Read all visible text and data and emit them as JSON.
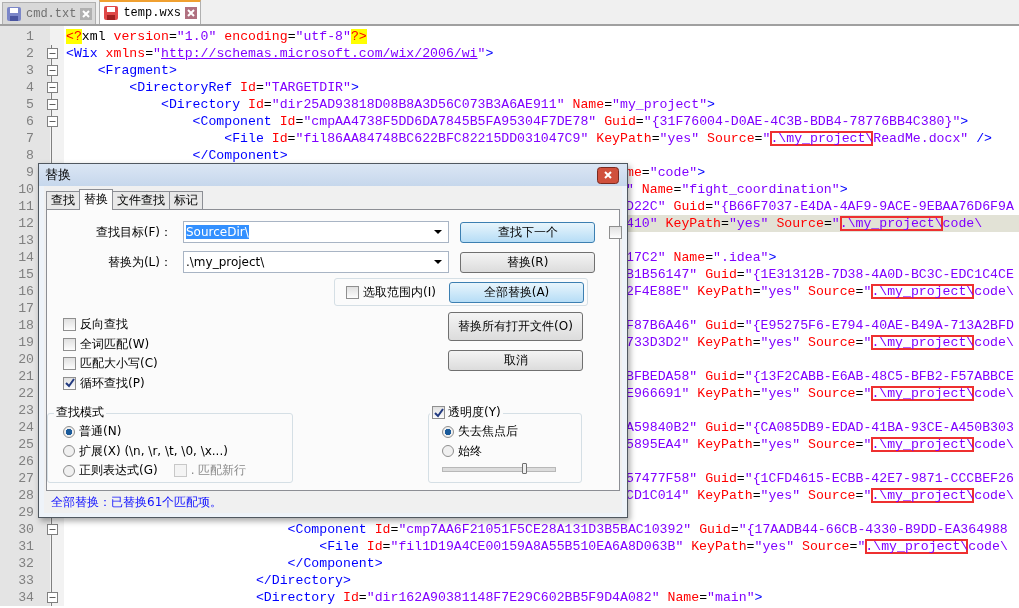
{
  "tabs": [
    {
      "label": "cmd.txt",
      "selected": false,
      "saved": true
    },
    {
      "label": "temp.wxs",
      "selected": true,
      "saved": false
    }
  ],
  "editor": {
    "lines": [
      {
        "number": "1",
        "kind": "full",
        "fold": false,
        "current": false,
        "tokens": [
          {
            "kind": "pi",
            "text": "<?"
          },
          {
            "kind": "plain",
            "text": "xml"
          },
          {
            "kind": "attr",
            "text": " version"
          },
          {
            "kind": "punct",
            "text": "="
          },
          {
            "kind": "value",
            "text": "\"1.0\""
          },
          {
            "kind": "attr",
            "text": " encoding"
          },
          {
            "kind": "punct",
            "text": "="
          },
          {
            "kind": "value",
            "text": "\"utf-8\""
          },
          {
            "kind": "pi",
            "text": "?>"
          }
        ]
      },
      {
        "number": "2",
        "kind": "full",
        "fold": true,
        "current": false,
        "tokens": [
          {
            "kind": "tag",
            "text": "<Wix"
          },
          {
            "kind": "attr",
            "text": " xmlns"
          },
          {
            "kind": "punct",
            "text": "="
          },
          {
            "kind": "value",
            "text": "\""
          },
          {
            "kind": "url",
            "text": "http://schemas.microsoft.com/wix/2006/wi"
          },
          {
            "kind": "value",
            "text": "\""
          },
          {
            "kind": "tag",
            "text": ">"
          }
        ]
      },
      {
        "number": "3",
        "kind": "full",
        "fold": true,
        "current": false,
        "tokens": [
          {
            "kind": "tag",
            "text": "    <Fragment>"
          }
        ]
      },
      {
        "number": "4",
        "kind": "full",
        "fold": true,
        "current": false,
        "tokens": [
          {
            "kind": "tag",
            "text": "        <DirectoryRef"
          },
          {
            "kind": "attr",
            "text": " Id"
          },
          {
            "kind": "punct",
            "text": "="
          },
          {
            "kind": "value",
            "text": "\"TARGETDIR\""
          },
          {
            "kind": "tag",
            "text": ">"
          }
        ]
      },
      {
        "number": "5",
        "kind": "full",
        "fold": true,
        "current": false,
        "tokens": [
          {
            "kind": "tag",
            "text": "            <Directory"
          },
          {
            "kind": "attr",
            "text": " Id"
          },
          {
            "kind": "punct",
            "text": "="
          },
          {
            "kind": "value",
            "text": "\"dir25AD93818D08B8A3D56C073B3A6AE911\""
          },
          {
            "kind": "attr",
            "text": " Name"
          },
          {
            "kind": "punct",
            "text": "="
          },
          {
            "kind": "value",
            "text": "\"my_project\""
          },
          {
            "kind": "tag",
            "text": ">"
          }
        ]
      },
      {
        "number": "6",
        "kind": "full",
        "fold": true,
        "current": false,
        "tokens": [
          {
            "kind": "tag",
            "text": "                <Component"
          },
          {
            "kind": "attr",
            "text": " Id"
          },
          {
            "kind": "punct",
            "text": "="
          },
          {
            "kind": "value",
            "text": "\"cmpAA4738F5DD6DA7845B5FA95304F7DE78\""
          },
          {
            "kind": "attr",
            "text": " Guid"
          },
          {
            "kind": "punct",
            "text": "="
          },
          {
            "kind": "value",
            "text": "\"{31F76004-D0AE-4C3B-BDB4-78776BB4C380}\""
          },
          {
            "kind": "tag",
            "text": ">"
          }
        ]
      },
      {
        "number": "7",
        "kind": "full",
        "fold": false,
        "current": false,
        "tokens": [
          {
            "kind": "tag",
            "text": "                    <File"
          },
          {
            "kind": "attr",
            "text": " Id"
          },
          {
            "kind": "punct",
            "text": "="
          },
          {
            "kind": "value",
            "text": "\"fil86AA84748BC622BFC82215DD031047C9\""
          },
          {
            "kind": "attr",
            "text": " KeyPath"
          },
          {
            "kind": "punct",
            "text": "="
          },
          {
            "kind": "value",
            "text": "\"yes\""
          },
          {
            "kind": "attr",
            "text": " Source"
          },
          {
            "kind": "punct",
            "text": "="
          },
          {
            "kind": "value",
            "text": "\""
          },
          {
            "kind": "match",
            "text": ".\\my_project\\"
          },
          {
            "kind": "value",
            "text": "ReadMe.docx\""
          },
          {
            "kind": "tag",
            "text": " />"
          }
        ]
      },
      {
        "number": "8",
        "kind": "full",
        "fold": false,
        "current": false,
        "tokens": [
          {
            "kind": "tag",
            "text": "                </Component>"
          }
        ]
      },
      {
        "number": "9",
        "kind": "covered",
        "current": false,
        "tokens": [
          {
            "kind": "attr",
            "text": "me"
          },
          {
            "kind": "punct",
            "text": "="
          },
          {
            "kind": "value",
            "text": "\"code\""
          },
          {
            "kind": "tag",
            "text": ">"
          }
        ]
      },
      {
        "number": "10",
        "kind": "covered",
        "current": false,
        "tokens": [
          {
            "kind": "value",
            "text": "\""
          },
          {
            "kind": "attr",
            "text": " Name"
          },
          {
            "kind": "punct",
            "text": "="
          },
          {
            "kind": "value",
            "text": "\"fight_coordination\""
          },
          {
            "kind": "tag",
            "text": ">"
          }
        ]
      },
      {
        "number": "11",
        "kind": "covered",
        "current": false,
        "tokens": [
          {
            "kind": "value",
            "text": "D22C\""
          },
          {
            "kind": "attr",
            "text": " Guid"
          },
          {
            "kind": "punct",
            "text": "="
          },
          {
            "kind": "value",
            "text": "\"{B66F7037-E4DA-4AF9-9ACE-9EBAA76D6F9A"
          }
        ]
      },
      {
        "number": "12",
        "kind": "covered",
        "current": true,
        "tokens": [
          {
            "kind": "value",
            "text": "410\""
          },
          {
            "kind": "attr",
            "text": " KeyPath"
          },
          {
            "kind": "punct",
            "text": "="
          },
          {
            "kind": "value",
            "text": "\"yes\""
          },
          {
            "kind": "attr",
            "text": " Source"
          },
          {
            "kind": "punct",
            "text": "="
          },
          {
            "kind": "value",
            "text": "\""
          },
          {
            "kind": "match",
            "text": ".\\my_project\\"
          },
          {
            "kind": "value",
            "text": "code\\"
          }
        ]
      },
      {
        "number": "13",
        "kind": "covered",
        "current": false
      },
      {
        "number": "14",
        "kind": "covered",
        "current": false,
        "tokens": [
          {
            "kind": "value",
            "text": "17C2\""
          },
          {
            "kind": "attr",
            "text": " Name"
          },
          {
            "kind": "punct",
            "text": "="
          },
          {
            "kind": "value",
            "text": "\".idea\""
          },
          {
            "kind": "tag",
            "text": ">"
          }
        ]
      },
      {
        "number": "15",
        "kind": "covered",
        "current": false,
        "tokens": [
          {
            "kind": "value",
            "text": "B1B56147\""
          },
          {
            "kind": "attr",
            "text": " Guid"
          },
          {
            "kind": "punct",
            "text": "="
          },
          {
            "kind": "value",
            "text": "\"{1E31312B-7D38-4A0D-BC3C-EDC1C4CE"
          }
        ]
      },
      {
        "number": "16",
        "kind": "covered",
        "current": false,
        "tokens": [
          {
            "kind": "value",
            "text": "2F4E88E\""
          },
          {
            "kind": "attr",
            "text": " KeyPath"
          },
          {
            "kind": "punct",
            "text": "="
          },
          {
            "kind": "value",
            "text": "\"yes\""
          },
          {
            "kind": "attr",
            "text": " Source"
          },
          {
            "kind": "punct",
            "text": "="
          },
          {
            "kind": "value",
            "text": "\""
          },
          {
            "kind": "match",
            "text": ".\\my_project\\"
          },
          {
            "kind": "value",
            "text": "code\\"
          }
        ]
      },
      {
        "number": "17",
        "kind": "covered",
        "current": false
      },
      {
        "number": "18",
        "kind": "covered",
        "current": false,
        "tokens": [
          {
            "kind": "value",
            "text": "F87B6A46\""
          },
          {
            "kind": "attr",
            "text": " Guid"
          },
          {
            "kind": "punct",
            "text": "="
          },
          {
            "kind": "value",
            "text": "\"{E95275F6-E794-40AE-B49A-713A2BFD"
          }
        ]
      },
      {
        "number": "19",
        "kind": "covered",
        "current": false,
        "tokens": [
          {
            "kind": "value",
            "text": "733D3D2\""
          },
          {
            "kind": "attr",
            "text": " KeyPath"
          },
          {
            "kind": "punct",
            "text": "="
          },
          {
            "kind": "value",
            "text": "\"yes\""
          },
          {
            "kind": "attr",
            "text": " Source"
          },
          {
            "kind": "punct",
            "text": "="
          },
          {
            "kind": "value",
            "text": "\""
          },
          {
            "kind": "match",
            "text": ".\\my_project\\"
          },
          {
            "kind": "value",
            "text": "code\\"
          }
        ]
      },
      {
        "number": "20",
        "kind": "covered",
        "current": false
      },
      {
        "number": "21",
        "kind": "covered",
        "current": false,
        "tokens": [
          {
            "kind": "value",
            "text": "BFBEDA58\""
          },
          {
            "kind": "attr",
            "text": " Guid"
          },
          {
            "kind": "punct",
            "text": "="
          },
          {
            "kind": "value",
            "text": "\"{13F2CABB-E6AB-48C5-BFB2-F57ABBCE"
          }
        ]
      },
      {
        "number": "22",
        "kind": "covered",
        "current": false,
        "tokens": [
          {
            "kind": "value",
            "text": "E966691\""
          },
          {
            "kind": "attr",
            "text": " KeyPath"
          },
          {
            "kind": "punct",
            "text": "="
          },
          {
            "kind": "value",
            "text": "\"yes\""
          },
          {
            "kind": "attr",
            "text": " Source"
          },
          {
            "kind": "punct",
            "text": "="
          },
          {
            "kind": "value",
            "text": "\""
          },
          {
            "kind": "match",
            "text": ".\\my_project\\"
          },
          {
            "kind": "value",
            "text": "code\\"
          }
        ]
      },
      {
        "number": "23",
        "kind": "covered",
        "current": false
      },
      {
        "number": "24",
        "kind": "covered",
        "current": false,
        "tokens": [
          {
            "kind": "value",
            "text": "A59840B2\""
          },
          {
            "kind": "attr",
            "text": " Guid"
          },
          {
            "kind": "punct",
            "text": "="
          },
          {
            "kind": "value",
            "text": "\"{CA085DB9-EDAD-41BA-93CE-A450B303"
          }
        ]
      },
      {
        "number": "25",
        "kind": "covered",
        "current": false,
        "tokens": [
          {
            "kind": "value",
            "text": "5895EA4\""
          },
          {
            "kind": "attr",
            "text": " KeyPath"
          },
          {
            "kind": "punct",
            "text": "="
          },
          {
            "kind": "value",
            "text": "\"yes\""
          },
          {
            "kind": "attr",
            "text": " Source"
          },
          {
            "kind": "punct",
            "text": "="
          },
          {
            "kind": "value",
            "text": "\""
          },
          {
            "kind": "match",
            "text": ".\\my_project\\"
          },
          {
            "kind": "value",
            "text": "code\\"
          }
        ]
      },
      {
        "number": "26",
        "kind": "covered",
        "current": false
      },
      {
        "number": "27",
        "kind": "covered",
        "current": false,
        "tokens": [
          {
            "kind": "value",
            "text": "57477F58\""
          },
          {
            "kind": "attr",
            "text": " Guid"
          },
          {
            "kind": "punct",
            "text": "="
          },
          {
            "kind": "value",
            "text": "\"{1CFD4615-ECBB-42E7-9871-CCCBEF26"
          }
        ]
      },
      {
        "number": "28",
        "kind": "covered",
        "current": false,
        "tokens": [
          {
            "kind": "value",
            "text": "CD1C014\""
          },
          {
            "kind": "attr",
            "text": " KeyPath"
          },
          {
            "kind": "punct",
            "text": "="
          },
          {
            "kind": "value",
            "text": "\"yes\""
          },
          {
            "kind": "attr",
            "text": " Source"
          },
          {
            "kind": "punct",
            "text": "="
          },
          {
            "kind": "value",
            "text": "\""
          },
          {
            "kind": "match",
            "text": ".\\my_project\\"
          },
          {
            "kind": "value",
            "text": "code\\"
          }
        ]
      },
      {
        "number": "29",
        "kind": "covered",
        "current": false
      },
      {
        "number": "30",
        "kind": "full",
        "fold": true,
        "current": false,
        "tokens": [
          {
            "kind": "tag",
            "text": "                            <Component"
          },
          {
            "kind": "attr",
            "text": " Id"
          },
          {
            "kind": "punct",
            "text": "="
          },
          {
            "kind": "value",
            "text": "\"cmp7AA6F21051F5CE28A131D3B5BAC10392\""
          },
          {
            "kind": "attr",
            "text": " Guid"
          },
          {
            "kind": "punct",
            "text": "="
          },
          {
            "kind": "value",
            "text": "\"{17AADB44-66CB-4330-B9DD-EA364988"
          }
        ]
      },
      {
        "number": "31",
        "kind": "full",
        "fold": false,
        "current": false,
        "tokens": [
          {
            "kind": "tag",
            "text": "                                <File"
          },
          {
            "kind": "attr",
            "text": " Id"
          },
          {
            "kind": "punct",
            "text": "="
          },
          {
            "kind": "value",
            "text": "\"fil1D19A4CE00159A8A55B510EA6A8D063B\""
          },
          {
            "kind": "attr",
            "text": " KeyPath"
          },
          {
            "kind": "punct",
            "text": "="
          },
          {
            "kind": "value",
            "text": "\"yes\""
          },
          {
            "kind": "attr",
            "text": " Source"
          },
          {
            "kind": "punct",
            "text": "="
          },
          {
            "kind": "value",
            "text": "\""
          },
          {
            "kind": "match",
            "text": ".\\my_project\\"
          },
          {
            "kind": "value",
            "text": "code\\"
          }
        ]
      },
      {
        "number": "32",
        "kind": "full",
        "fold": false,
        "current": false,
        "tokens": [
          {
            "kind": "tag",
            "text": "                            </Component>"
          }
        ]
      },
      {
        "number": "33",
        "kind": "full",
        "fold": false,
        "current": false,
        "tokens": [
          {
            "kind": "tag",
            "text": "                        </Directory>"
          }
        ]
      },
      {
        "number": "34",
        "kind": "full",
        "fold": true,
        "current": false,
        "tokens": [
          {
            "kind": "tag",
            "text": "                        <Directory"
          },
          {
            "kind": "attr",
            "text": " Id"
          },
          {
            "kind": "punct",
            "text": "="
          },
          {
            "kind": "value",
            "text": "\"dir162A90381148F7E29C602BB5F9D4A082\""
          },
          {
            "kind": "attr",
            "text": " Name"
          },
          {
            "kind": "punct",
            "text": "="
          },
          {
            "kind": "value",
            "text": "\"main\""
          },
          {
            "kind": "tag",
            "text": ">"
          }
        ]
      }
    ]
  },
  "dialog": {
    "title": "替换",
    "tabs": [
      {
        "label": "查找",
        "selected": false
      },
      {
        "label": "替换",
        "selected": true
      },
      {
        "label": "文件查找",
        "selected": false
      },
      {
        "label": "标记",
        "selected": false
      }
    ],
    "find": {
      "label": "查找目标(F)：",
      "value": "SourceDir\\"
    },
    "replace": {
      "label": "替换为(L)：",
      "value": ".\\my_project\\"
    },
    "find_next_button": {
      "label": "查找下一个",
      "highlighted": true
    },
    "extra_checkbox": {
      "checked": false
    },
    "replace_button": {
      "label": "替换(R)",
      "highlighted": false
    },
    "in_selection": {
      "label": "选取范围内(I)",
      "checked": false
    },
    "replace_all_button": {
      "label": "全部替换(A)",
      "highlighted": true
    },
    "replace_all_open_button": {
      "label": "替换所有打开文件(O)",
      "highlighted": false
    },
    "cancel_button": {
      "label": "取消",
      "highlighted": false
    },
    "options": [
      {
        "label": "反向查找",
        "checked": false
      },
      {
        "label": "全词匹配(W)",
        "checked": false
      },
      {
        "label": "匹配大小写(C)",
        "checked": false
      },
      {
        "label": "循环查找(P)",
        "checked": true
      }
    ],
    "search_mode": {
      "title": "查找模式",
      "options": [
        {
          "label": "普通(N)",
          "selected": true
        },
        {
          "label": "扩展(X) (\\n, \\r, \\t, \\0, \\x...)",
          "selected": false
        },
        {
          "label": "正则表达式(G)",
          "selected": false
        }
      ],
      "dot_newline": {
        "label": ". 匹配新行",
        "checked": false,
        "disabled": true
      }
    },
    "transparency": {
      "label": "透明度(Y)",
      "checked": true,
      "options": [
        {
          "label": "失去焦点后",
          "selected": true
        },
        {
          "label": "始终",
          "selected": false
        }
      ],
      "level": 0.72
    },
    "status": "全部替换：已替换61个匹配项。"
  }
}
